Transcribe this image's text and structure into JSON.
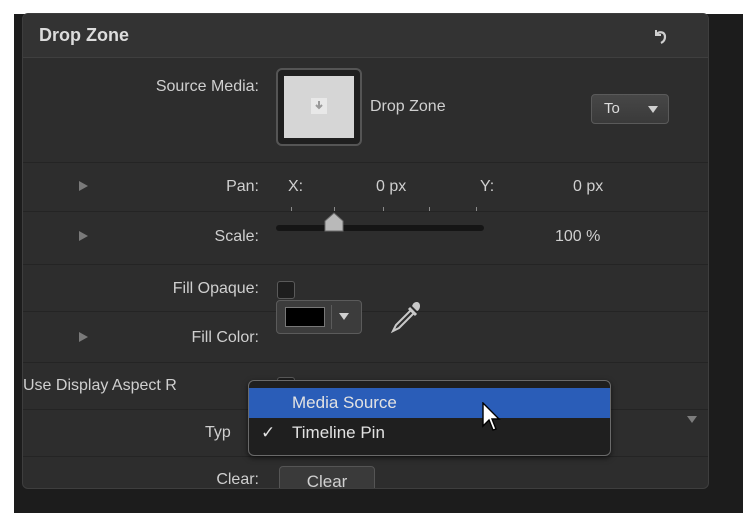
{
  "header": {
    "title": "Drop Zone",
    "reset_icon": "reset-arrow-icon"
  },
  "source_media": {
    "label": "Source Media:",
    "thumb_icon": "download-icon",
    "name": "Drop Zone",
    "popup_value": "To"
  },
  "pan": {
    "label": "Pan:",
    "x_label": "X:",
    "x_value": "0 px",
    "y_label": "Y:",
    "y_value": "0 px"
  },
  "scale": {
    "label": "Scale:",
    "value": "100 %"
  },
  "fill_opaque": {
    "label": "Fill Opaque:",
    "checked": false
  },
  "fill_color": {
    "label": "Fill Color:",
    "color": "#000000",
    "dropper_icon": "eyedropper-icon"
  },
  "use_display_aspect": {
    "label": "Use Display Aspect R",
    "checked": false
  },
  "type": {
    "label": "Typ"
  },
  "clear": {
    "label": "Clear:",
    "button": "Clear"
  },
  "menu": {
    "items": [
      {
        "label": "Media Source",
        "checked": false,
        "highlighted": true
      },
      {
        "label": "Timeline Pin",
        "checked": true,
        "check_glyph": "✓",
        "highlighted": false
      }
    ]
  },
  "colors": {
    "highlight": "#2a5db8",
    "panel": "#2d2d2d",
    "frame": "#1c1c1c"
  }
}
